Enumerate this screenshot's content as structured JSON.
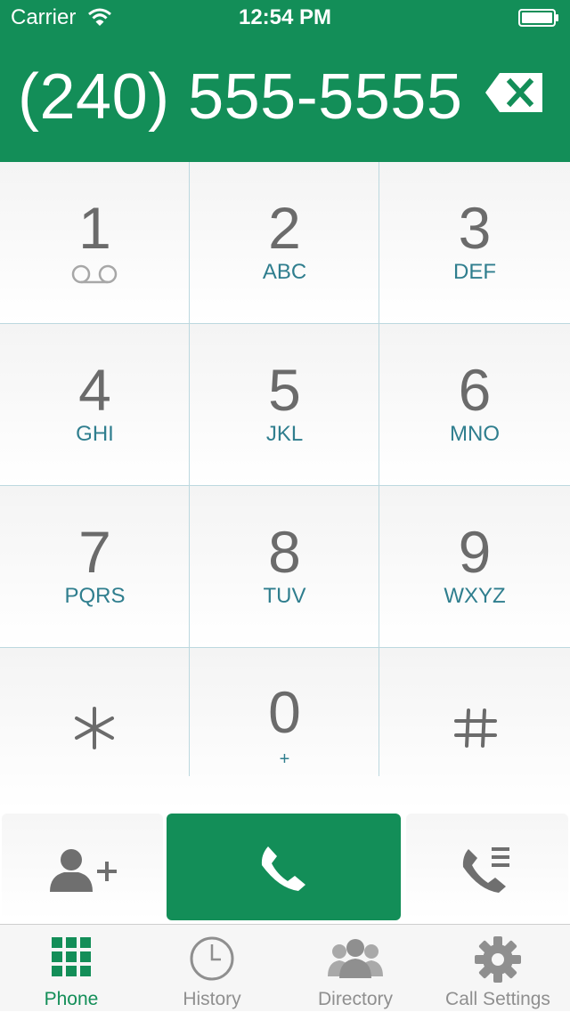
{
  "status": {
    "carrier": "Carrier",
    "time": "12:54 PM"
  },
  "dialer": {
    "number": "(240) 555-5555"
  },
  "keys": [
    {
      "digit": "1",
      "letters": ""
    },
    {
      "digit": "2",
      "letters": "ABC"
    },
    {
      "digit": "3",
      "letters": "DEF"
    },
    {
      "digit": "4",
      "letters": "GHI"
    },
    {
      "digit": "5",
      "letters": "JKL"
    },
    {
      "digit": "6",
      "letters": "MNO"
    },
    {
      "digit": "7",
      "letters": "PQRS"
    },
    {
      "digit": "8",
      "letters": "TUV"
    },
    {
      "digit": "9",
      "letters": "WXYZ"
    },
    {
      "digit": "",
      "letters": ""
    },
    {
      "digit": "0",
      "letters": "+"
    },
    {
      "digit": "",
      "letters": ""
    }
  ],
  "tabs": [
    {
      "label": "Phone",
      "icon": "grid-icon"
    },
    {
      "label": "History",
      "icon": "clock-icon"
    },
    {
      "label": "Directory",
      "icon": "people-icon"
    },
    {
      "label": "Call Settings",
      "icon": "gear-icon"
    }
  ],
  "colors": {
    "brand": "#138e58",
    "digit": "#6b6b6b",
    "letters": "#2f7e8e",
    "tab_inactive": "#8f8f8f"
  }
}
